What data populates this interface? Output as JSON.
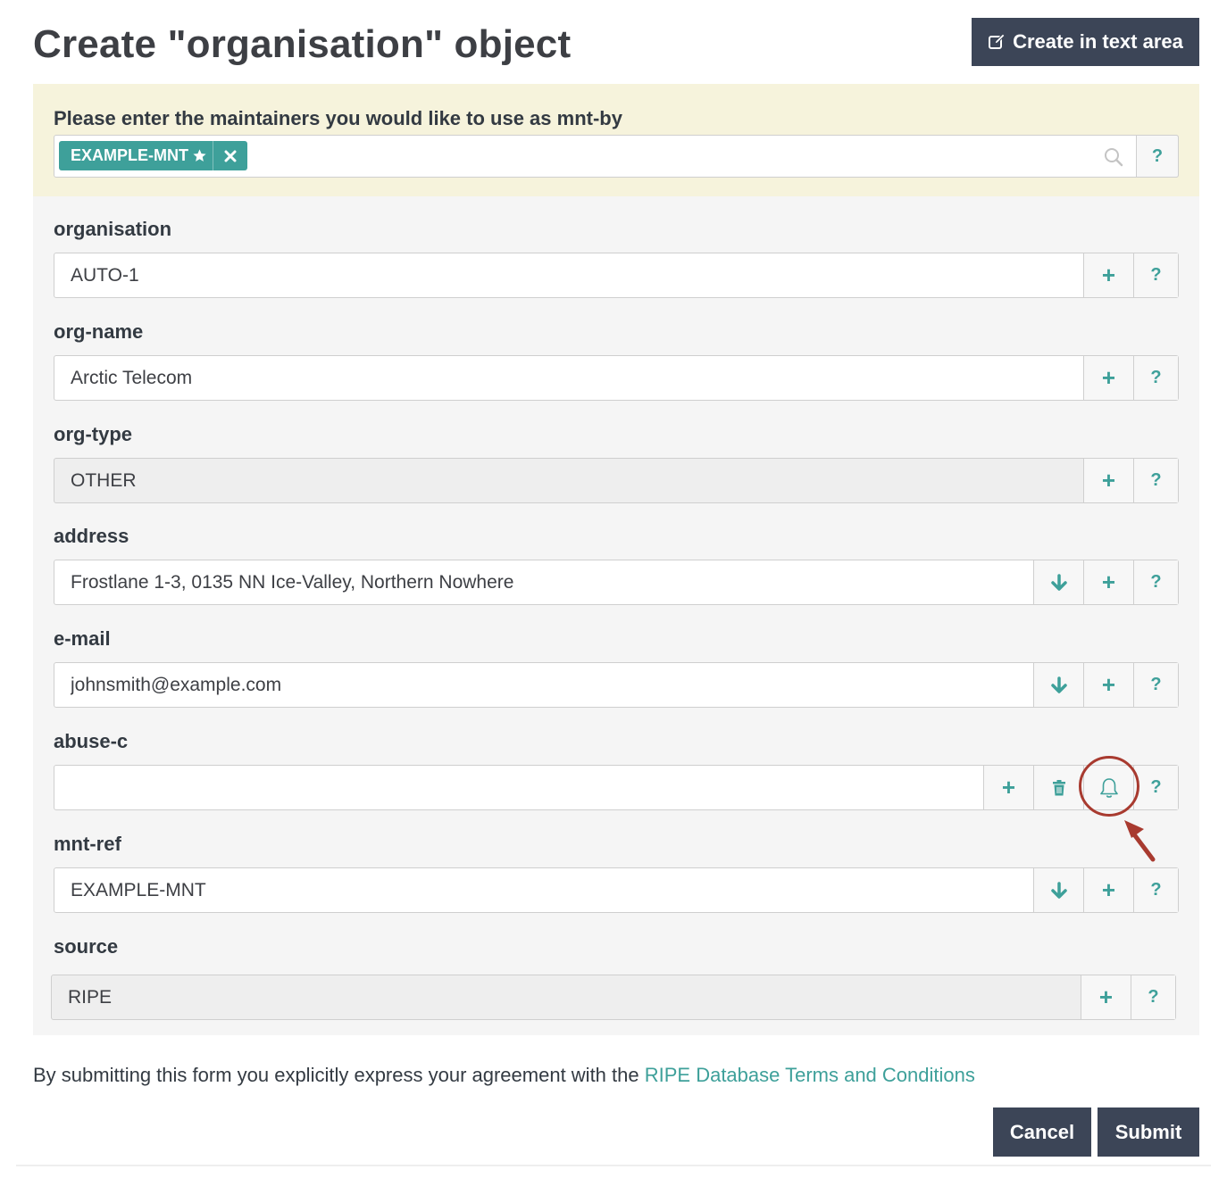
{
  "header": {
    "title": "Create \"organisation\" object",
    "create_text_area_label": "Create in text area"
  },
  "mnt_by": {
    "label": "Please enter the maintainers you would like to use as mnt-by",
    "tags": [
      {
        "name": "EXAMPLE-MNT"
      }
    ],
    "help_label": "?"
  },
  "fields": [
    {
      "label": "organisation",
      "value": "AUTO-1",
      "readonly": false,
      "buttons": [
        "add",
        "help"
      ]
    },
    {
      "label": "org-name",
      "value": "Arctic Telecom",
      "readonly": false,
      "buttons": [
        "add",
        "help"
      ]
    },
    {
      "label": "org-type",
      "value": "OTHER",
      "readonly": true,
      "buttons": [
        "add",
        "help"
      ]
    },
    {
      "label": "address",
      "value": "Frostlane 1-3, 0135 NN Ice-Valley, Northern Nowhere",
      "readonly": false,
      "buttons": [
        "down",
        "add",
        "help"
      ]
    },
    {
      "label": "e-mail",
      "value": "johnsmith@example.com",
      "readonly": false,
      "buttons": [
        "down",
        "add",
        "help"
      ]
    },
    {
      "label": "abuse-c",
      "value": "",
      "readonly": false,
      "buttons": [
        "add",
        "delete",
        "bell",
        "help"
      ]
    },
    {
      "label": "mnt-ref",
      "value": "EXAMPLE-MNT",
      "readonly": false,
      "buttons": [
        "down",
        "add",
        "help"
      ]
    },
    {
      "label": "source",
      "value": "RIPE",
      "readonly": true,
      "buttons": [
        "add",
        "help"
      ]
    }
  ],
  "buttons": {
    "add": "+",
    "help": "?"
  },
  "footer": {
    "terms_prefix": "By submitting this form you explicitly express your agreement with the ",
    "terms_link": "RIPE Database Terms and Conditions",
    "cancel_label": "Cancel",
    "submit_label": "Submit"
  },
  "colors": {
    "accent": "#3ea09a",
    "dark_button": "#3c4557",
    "mntby_background": "#f6f3dc",
    "annotation": "#a83a2f"
  }
}
